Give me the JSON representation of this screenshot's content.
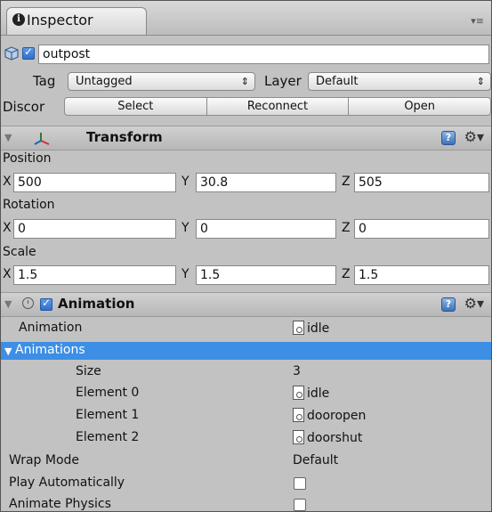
{
  "tab": {
    "icon": "info-icon",
    "label": "Inspector",
    "menu": "▾≡"
  },
  "object": {
    "name": "outpost",
    "active": true
  },
  "tag": {
    "label": "Tag",
    "value": "Untagged"
  },
  "layer": {
    "label": "Layer",
    "value": "Default"
  },
  "prefab": {
    "label": "Discor",
    "buttons": [
      "Select",
      "Reconnect",
      "Open"
    ]
  },
  "transform": {
    "title": "Transform",
    "position": {
      "label": "Position",
      "x": "500",
      "y": "30.8",
      "z": "505"
    },
    "rotation": {
      "label": "Rotation",
      "x": "0",
      "y": "0",
      "z": "0"
    },
    "scale": {
      "label": "Scale",
      "x": "1.5",
      "y": "1.5",
      "z": "1.5"
    },
    "axis": {
      "x": "X",
      "y": "Y",
      "z": "Z"
    }
  },
  "animation": {
    "title": "Animation",
    "enabled": true,
    "animation_label": "Animation",
    "animation_value": "idle",
    "animations_label": "Animations",
    "size_label": "Size",
    "size_value": "3",
    "elements": [
      {
        "label": "Element 0",
        "value": "idle"
      },
      {
        "label": "Element 1",
        "value": "dooropen"
      },
      {
        "label": "Element 2",
        "value": "doorshut"
      }
    ],
    "wrap_label": "Wrap Mode",
    "wrap_value": "Default",
    "play_label": "Play Automatically",
    "play_checked": false,
    "physics_label": "Animate Physics",
    "physics_checked": false
  },
  "colors": {
    "selection": "#3d8ee5",
    "panel": "#c2c2c2"
  }
}
